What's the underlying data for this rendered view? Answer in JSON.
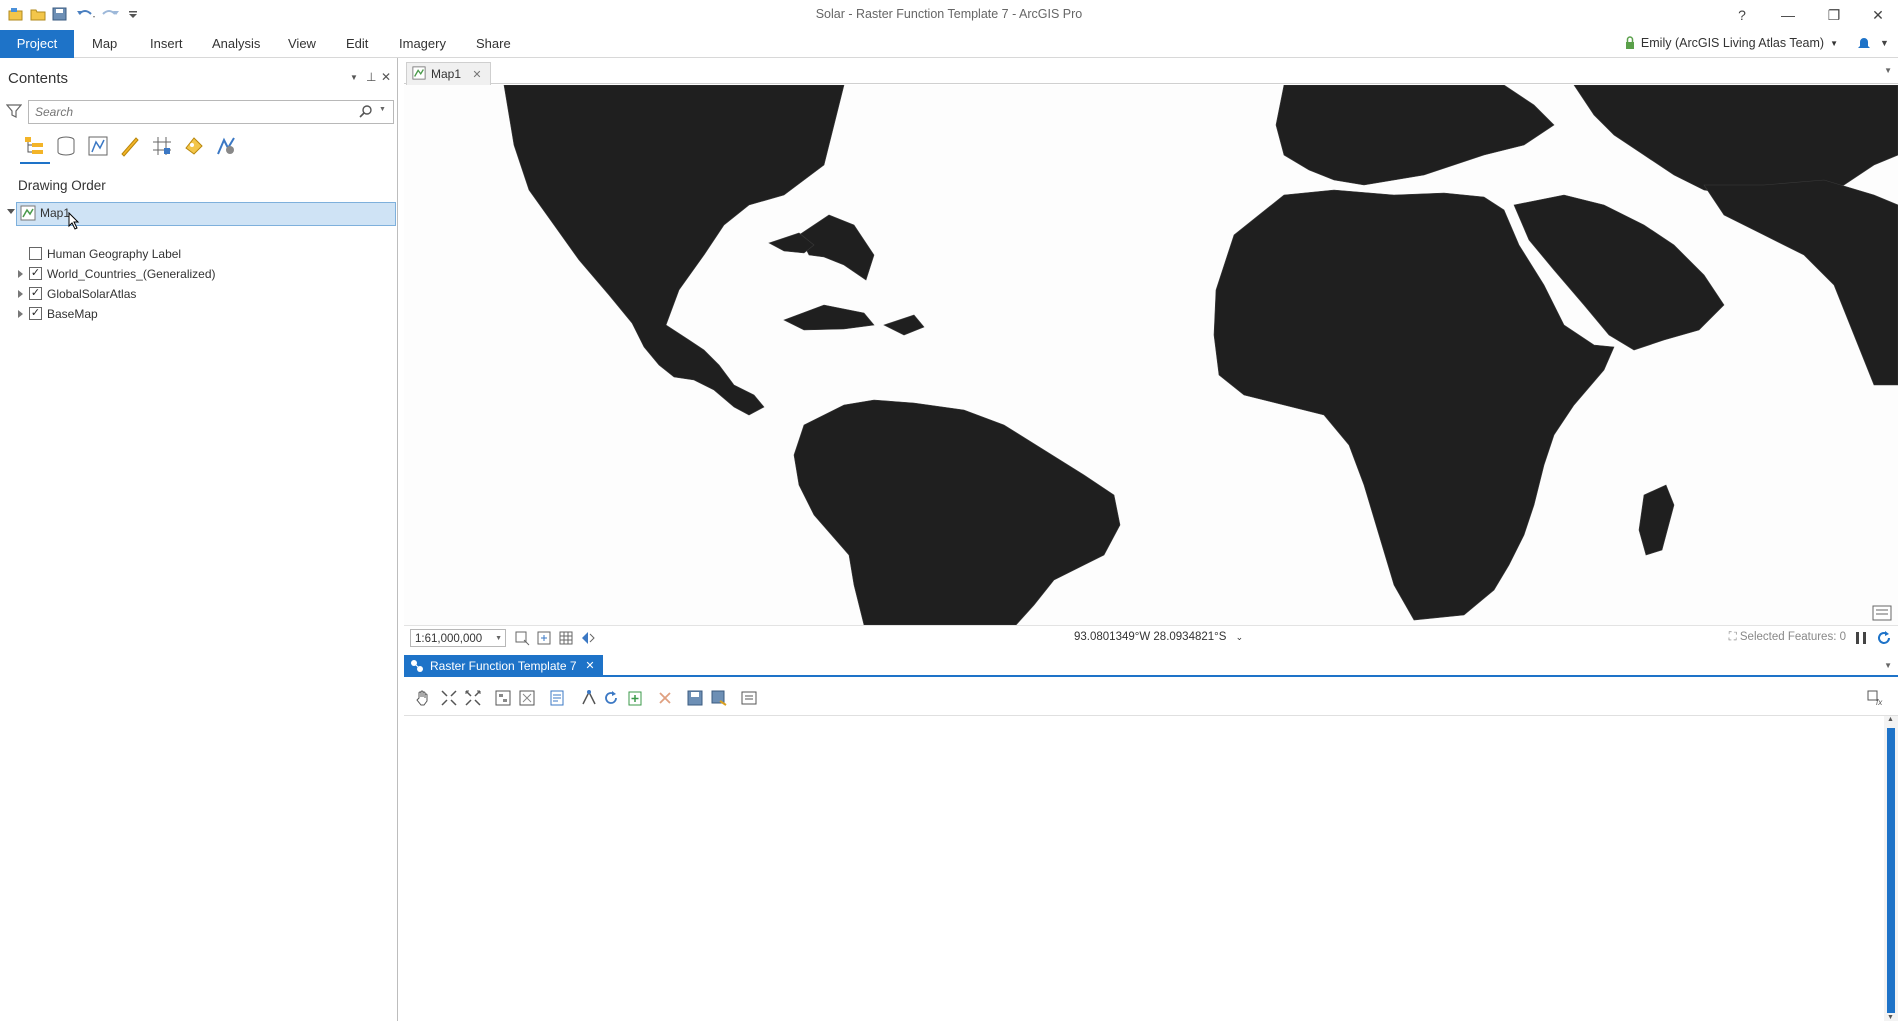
{
  "window": {
    "title": "Solar - Raster Function Template 7 - ArcGIS Pro",
    "help": "?",
    "minimize": "—",
    "restore": "❐",
    "close": "✕"
  },
  "quick_access": [
    "new-project-icon",
    "open-icon",
    "save-icon",
    "undo-icon",
    "redo-icon",
    "customize-icon"
  ],
  "ribbon": {
    "tabs": [
      "Project",
      "Map",
      "Insert",
      "Analysis",
      "View",
      "Edit",
      "Imagery",
      "Share"
    ],
    "active_tab": "Project",
    "user": "Emily (ArcGIS Living Atlas Team)"
  },
  "contents": {
    "title": "Contents",
    "search_placeholder": "Search",
    "section_title": "Drawing Order",
    "map_name": "Map1",
    "layers": [
      {
        "name": "Human Geography Label",
        "checked": false,
        "expandable": false
      },
      {
        "name": "World_Countries_(Generalized)",
        "checked": true,
        "expandable": true
      },
      {
        "name": "GlobalSolarAtlas",
        "checked": true,
        "expandable": true
      },
      {
        "name": "BaseMap",
        "checked": true,
        "expandable": true
      }
    ]
  },
  "map_view": {
    "tab_label": "Map1",
    "scale": "1:61,000,000",
    "coordinates": "93.0801349°W 28.0934821°S",
    "selected_features": "Selected Features: 0"
  },
  "raster_function": {
    "tab_label": "Raster Function Template 7"
  },
  "colors": {
    "accent": "#1e73c8",
    "land": "#1f1f1f",
    "water": "#fdfdfd"
  }
}
